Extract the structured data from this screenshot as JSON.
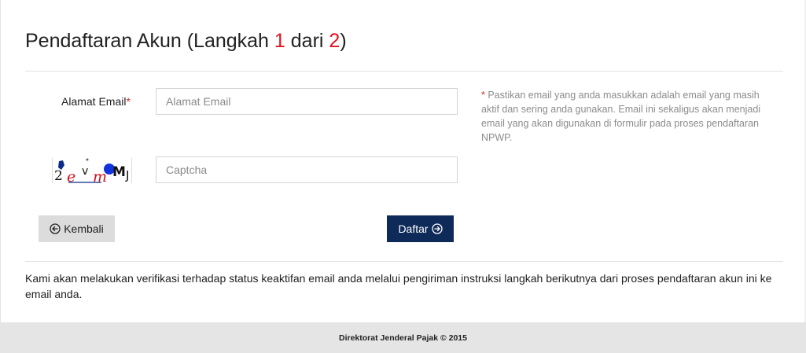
{
  "header": {
    "title_prefix": "Pendaftaran Akun  (Langkah ",
    "step_current": "1",
    "title_mid": " dari ",
    "step_total": "2",
    "title_suffix": ")"
  },
  "form": {
    "email_label": "Alamat Email",
    "required_mark": "*",
    "email_placeholder": "Alamat Email",
    "email_value": "",
    "captcha_placeholder": "Captcha",
    "captcha_value": "",
    "captcha_image_text": "2evmMJ"
  },
  "note": {
    "marker": "*",
    "text": " Pastikan email yang anda masukkan adalah email yang masih aktif dan sering anda gunakan. Email ini sekaligus akan menjadi email yang akan digunakan di formulir pada proses pendaftaran NPWP."
  },
  "buttons": {
    "back_label": "Kembali",
    "back_icon": "arrow-left-circle-icon",
    "submit_label": "Daftar",
    "submit_icon": "arrow-right-circle-icon"
  },
  "info_text": "Kami akan melakukan verifikasi terhadap status keaktifan email anda melalui pengiriman instruksi langkah berikutnya dari proses pendaftaran akun ini ke email anda.",
  "footer": {
    "text": "Direktorat Jenderal Pajak © 2015"
  },
  "colors": {
    "accent_red": "#e0141e",
    "submit_bg": "#0e2a59",
    "back_bg": "#dcdcdc",
    "footer_bg": "#e5e5e5"
  }
}
